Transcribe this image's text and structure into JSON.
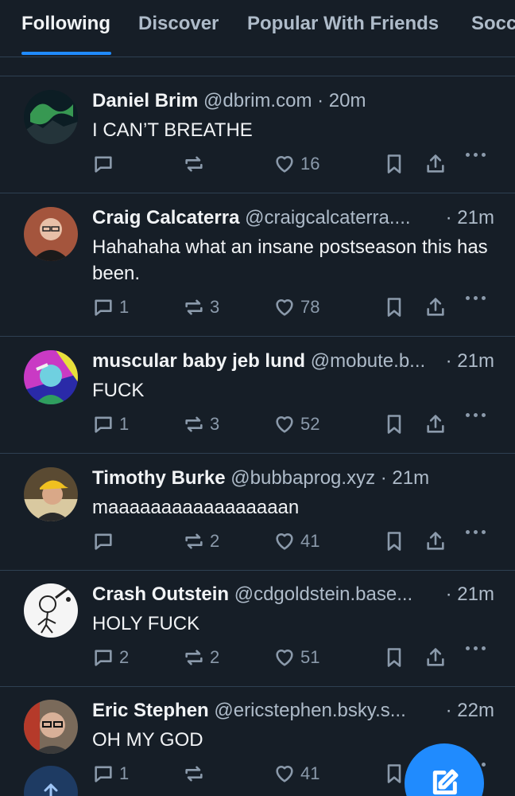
{
  "tabs": [
    {
      "label": "Following",
      "active": true
    },
    {
      "label": "Discover",
      "active": false
    },
    {
      "label": "Popular With Friends",
      "active": false
    },
    {
      "label": "Socc",
      "active": false
    }
  ],
  "colors": {
    "accent": "#208bfe",
    "background": "#161e27",
    "muted": "#aebbc9",
    "border": "#2e4052"
  },
  "posts": [
    {
      "name": "Daniel Brim",
      "handle": "@dbrim.com",
      "time": "· 20m",
      "text": "I CAN’T BREATHE",
      "replies": "",
      "reposts": "",
      "likes": "16",
      "avatar_icon": "aurora-avatar"
    },
    {
      "name": "Craig Calcaterra",
      "handle": "@craigcalcaterra....",
      "time": "· 21m",
      "text": "Hahahaha what an insane postseason this has been.",
      "replies": "1",
      "reposts": "3",
      "likes": "78",
      "avatar_icon": "man-glasses-avatar"
    },
    {
      "name": "muscular baby jeb lund",
      "handle": "@mobute.b...",
      "time": "· 21m",
      "text": "FUCK",
      "replies": "1",
      "reposts": "3",
      "likes": "52",
      "avatar_icon": "colorful-saluting-avatar"
    },
    {
      "name": "Timothy Burke",
      "handle": "@bubbaprog.xyz",
      "time": "· 21m",
      "text": "maaaaaaaaaaaaaaaaan",
      "replies": "",
      "reposts": "2",
      "likes": "41",
      "avatar_icon": "man-yellow-cap-avatar"
    },
    {
      "name": "Crash Outstein",
      "handle": "@cdgoldstein.base...",
      "time": "· 21m",
      "text": "HOLY FUCK",
      "replies": "2",
      "reposts": "2",
      "likes": "51",
      "avatar_icon": "cartoon-batter-avatar"
    },
    {
      "name": "Eric Stephen",
      "handle": "@ericstephen.bsky.s...",
      "time": "· 22m",
      "text": "OH MY GOD",
      "replies": "1",
      "reposts": "",
      "likes": "41",
      "avatar_icon": "man-glasses-avatar"
    }
  ]
}
